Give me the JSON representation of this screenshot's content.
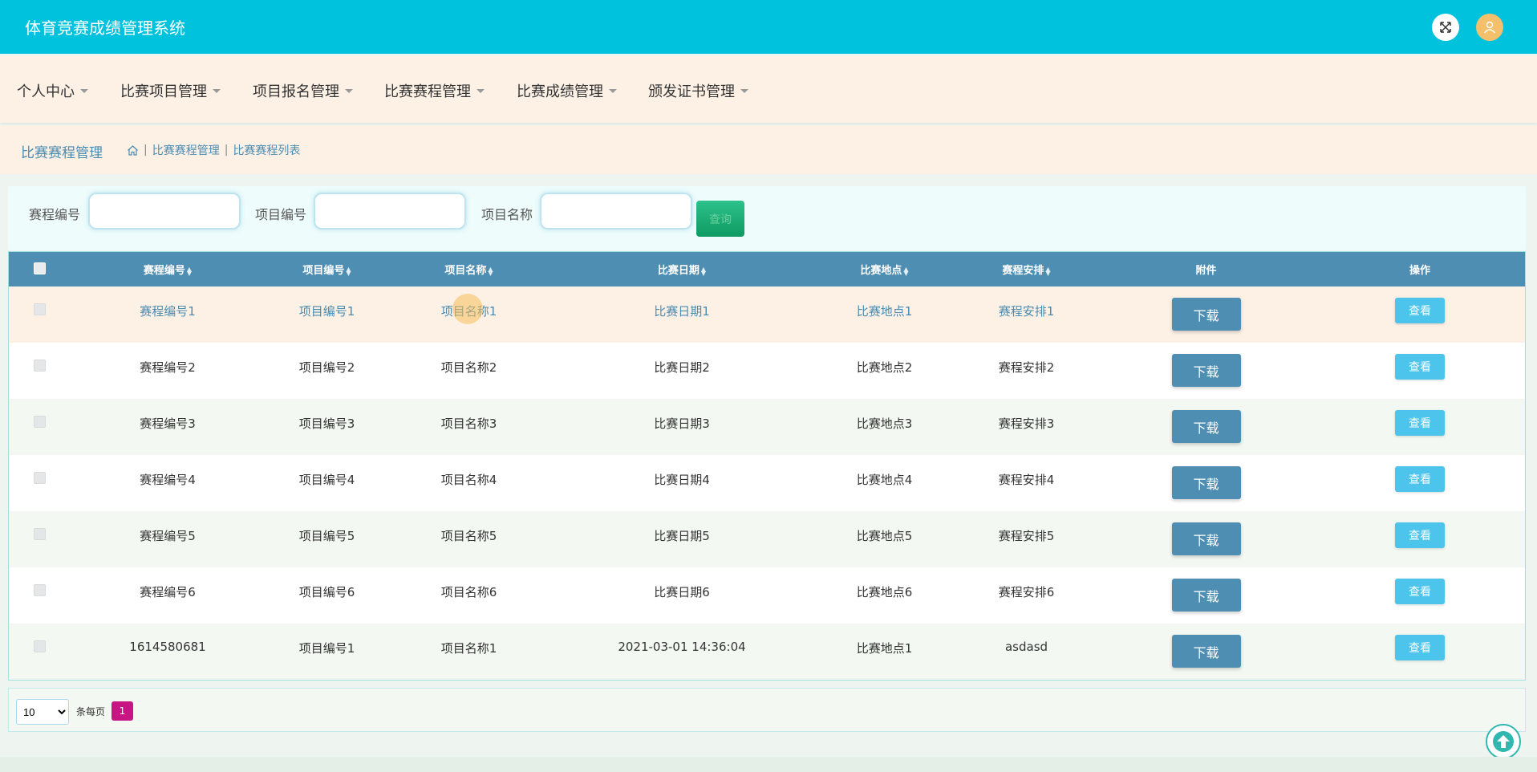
{
  "header": {
    "title": "体育竞赛成绩管理系统"
  },
  "nav": {
    "items": [
      {
        "label": "个人中心"
      },
      {
        "label": "比赛项目管理"
      },
      {
        "label": "项目报名管理"
      },
      {
        "label": "比赛赛程管理"
      },
      {
        "label": "比赛成绩管理"
      },
      {
        "label": "颁发证书管理"
      }
    ]
  },
  "breadcrumb": {
    "title": "比赛赛程管理",
    "items": [
      "比赛赛程管理",
      "比赛赛程列表"
    ]
  },
  "search": {
    "fields": [
      {
        "label": "赛程编号",
        "value": ""
      },
      {
        "label": "项目编号",
        "value": ""
      },
      {
        "label": "项目名称",
        "value": ""
      }
    ],
    "button_label": "查询"
  },
  "table": {
    "columns": [
      "赛程编号",
      "项目编号",
      "项目名称",
      "比赛日期",
      "比赛地点",
      "赛程安排",
      "附件",
      "操作"
    ],
    "rows": [
      {
        "schedule_no": "赛程编号1",
        "project_no": "项目编号1",
        "project_name": "项目名称1",
        "date": "比赛日期1",
        "place": "比赛地点1",
        "arrangement": "赛程安排1"
      },
      {
        "schedule_no": "赛程编号2",
        "project_no": "项目编号2",
        "project_name": "项目名称2",
        "date": "比赛日期2",
        "place": "比赛地点2",
        "arrangement": "赛程安排2"
      },
      {
        "schedule_no": "赛程编号3",
        "project_no": "项目编号3",
        "project_name": "项目名称3",
        "date": "比赛日期3",
        "place": "比赛地点3",
        "arrangement": "赛程安排3"
      },
      {
        "schedule_no": "赛程编号4",
        "project_no": "项目编号4",
        "project_name": "项目名称4",
        "date": "比赛日期4",
        "place": "比赛地点4",
        "arrangement": "赛程安排4"
      },
      {
        "schedule_no": "赛程编号5",
        "project_no": "项目编号5",
        "project_name": "项目名称5",
        "date": "比赛日期5",
        "place": "比赛地点5",
        "arrangement": "赛程安排5"
      },
      {
        "schedule_no": "赛程编号6",
        "project_no": "项目编号6",
        "project_name": "项目名称6",
        "date": "比赛日期6",
        "place": "比赛地点6",
        "arrangement": "赛程安排6"
      },
      {
        "schedule_no": "1614580681",
        "project_no": "项目编号1",
        "project_name": "项目名称1",
        "date": "2021-03-01 14:36:04",
        "place": "比赛地点1",
        "arrangement": "asdasd"
      }
    ],
    "download_label": "下载",
    "view_label": "查看"
  },
  "pagination": {
    "page_size": "10",
    "per_page_label": "条每页",
    "current_page": "1"
  },
  "colors": {
    "header_bg": "#00c2dd",
    "nav_bg": "#fdf1e6",
    "table_header_bg": "#4e8eb2",
    "view_button": "#4cc4ec",
    "page_active": "#c71584"
  },
  "icons": {
    "fullscreen": "fullscreen-icon",
    "user": "user-icon",
    "home": "home-icon",
    "scroll_top": "arrow-up-icon"
  }
}
